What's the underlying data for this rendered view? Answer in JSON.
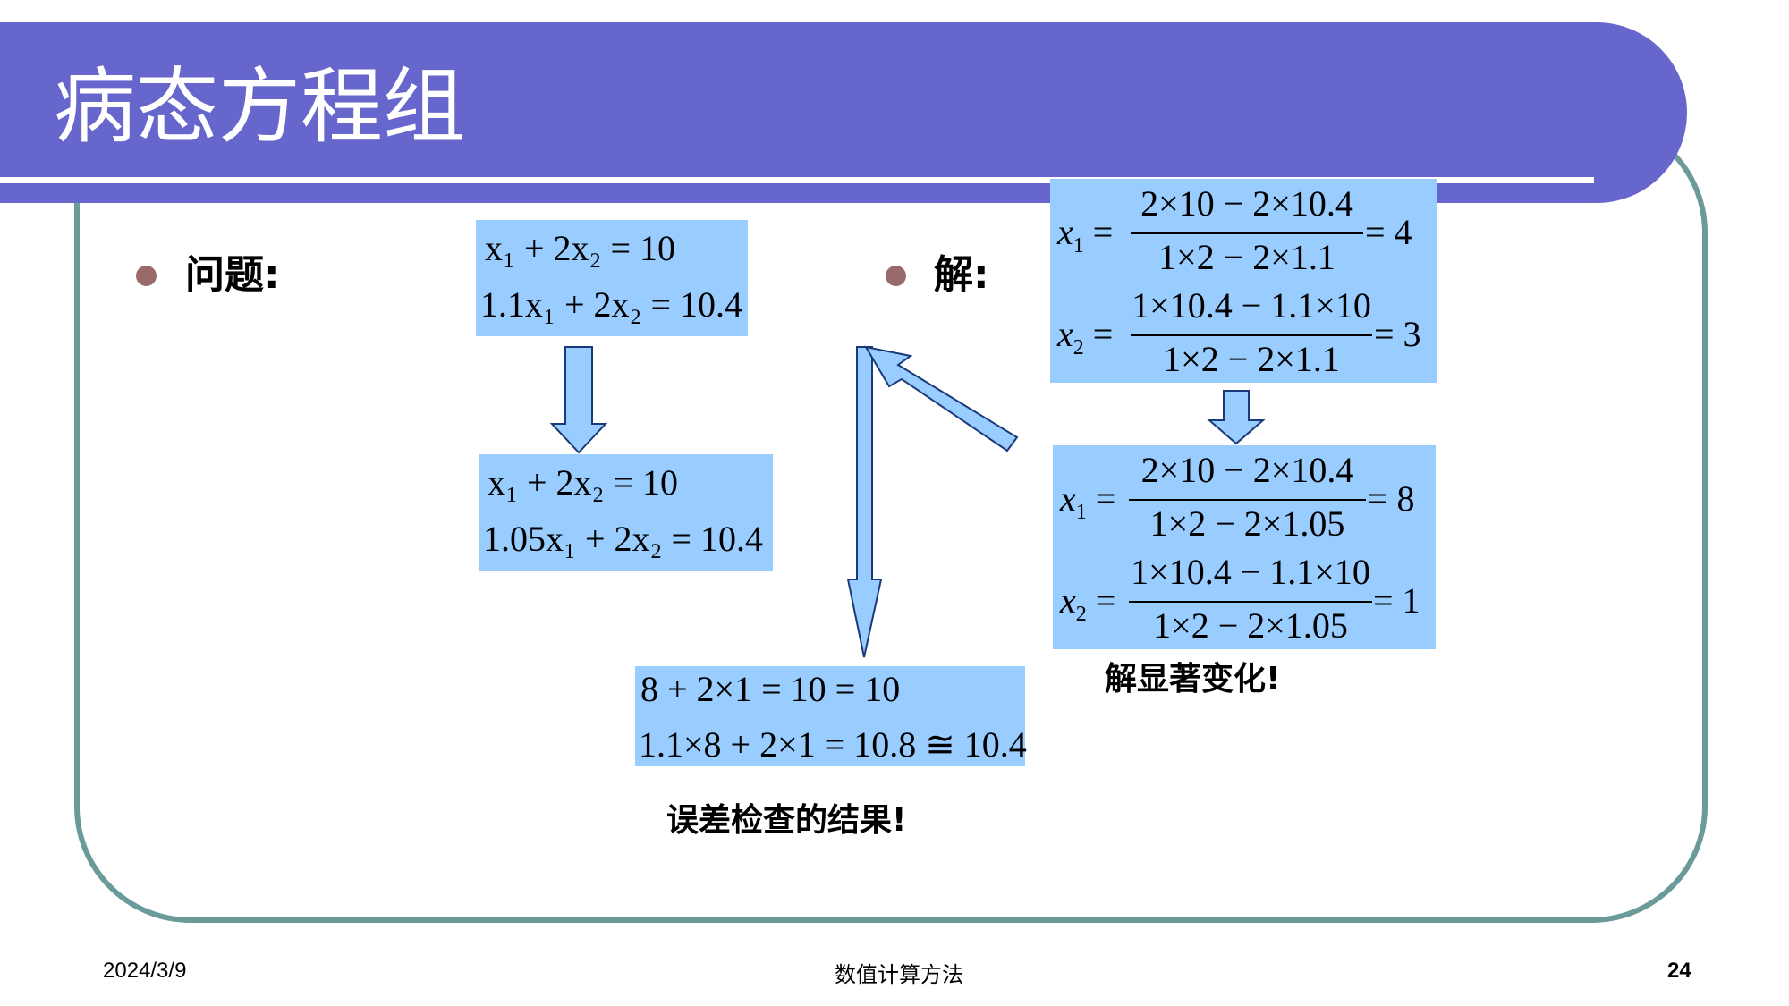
{
  "header": {
    "title": "病态方程组"
  },
  "problem": {
    "label": "问题:",
    "original_system": [
      "x₁ + 2x₂ = 10",
      "1.1x₁ + 2x₂ = 10.4"
    ],
    "perturbed_system": [
      "x₁ + 2x₂ = 10",
      "1.05x₁ + 2x₂ = 10.4"
    ]
  },
  "solution": {
    "label": "解:",
    "original": {
      "x1_num": "2×10 − 2×10.4",
      "x1_den": "1×2 − 2×1.1",
      "x1_val": "= 4",
      "x2_num": "1×10.4 − 1.1×10",
      "x2_den": "1×2 − 2×1.1",
      "x2_val": "= 3"
    },
    "perturbed": {
      "x1_num": "2×10 − 2×10.4",
      "x1_den": "1×2 − 2×1.05",
      "x1_val": "= 8",
      "x2_num": "1×10.4 − 1.1×10",
      "x2_den": "1×2 − 2×1.05",
      "x2_val": "= 1"
    },
    "caption": "解显著变化!"
  },
  "check": {
    "lines": [
      "8 + 2×1 = 10 = 10",
      "1.1×8 + 2×1 = 10.8 ≅ 10.4"
    ],
    "caption": "误差检查的结果!"
  },
  "footer": {
    "date": "2024/3/9",
    "course": "数值计算方法",
    "page": "24"
  },
  "colors": {
    "title_bar": "#6666cc",
    "frame": "#6a9a9a",
    "box": "#99ccff",
    "bullet": "#9a6a6a"
  }
}
